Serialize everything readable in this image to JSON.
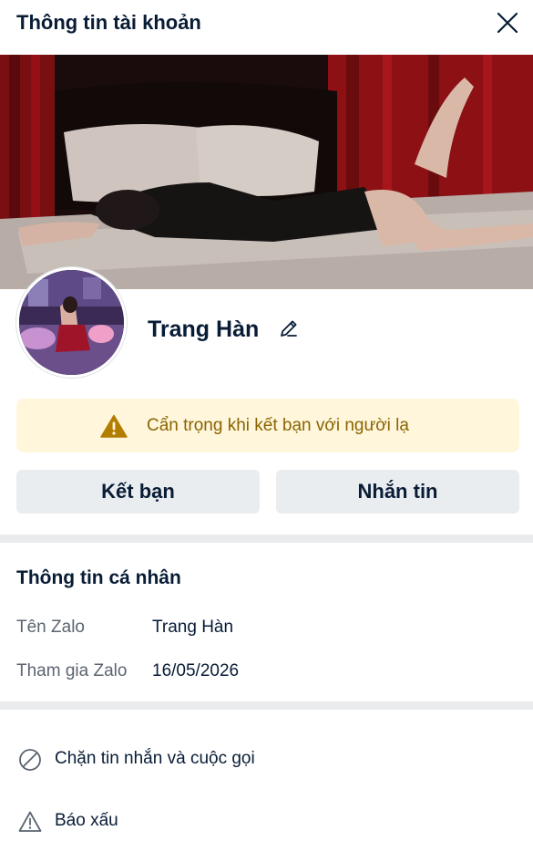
{
  "header": {
    "title": "Thông tin tài khoản"
  },
  "profile": {
    "name": "Trang Hàn"
  },
  "warning": {
    "text": "Cẩn trọng khi kết bạn với người lạ"
  },
  "buttons": {
    "add_friend": "Kết bạn",
    "message": "Nhắn tin"
  },
  "personal_info": {
    "title": "Thông tin cá nhân",
    "rows": [
      {
        "label": "Tên Zalo",
        "value": "Trang Hàn"
      },
      {
        "label": "Tham gia Zalo",
        "value": "16/05/2026"
      }
    ]
  },
  "actions": [
    {
      "label": "Chặn tin nhắn và cuộc gọi",
      "icon": "block-icon"
    },
    {
      "label": "Báo xấu",
      "icon": "warning-triangle-icon"
    }
  ],
  "colors": {
    "text_primary": "#081c36",
    "text_secondary": "#5b6470",
    "warning_bg": "#fff6dc",
    "warning_text": "#8a6400",
    "button_bg": "#eaedf0",
    "divider": "#e9ebed"
  }
}
